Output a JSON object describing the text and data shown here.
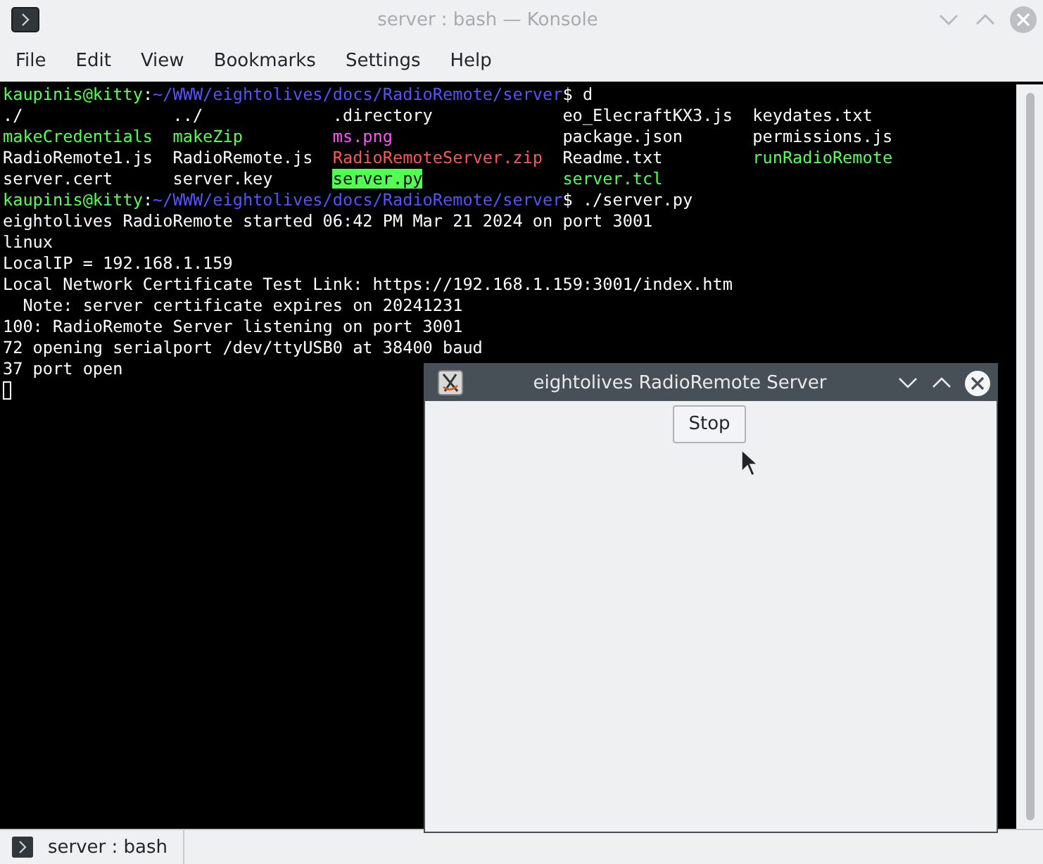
{
  "window": {
    "title": "server : bash — Konsole"
  },
  "menu": [
    "File",
    "Edit",
    "View",
    "Bookmarks",
    "Settings",
    "Help"
  ],
  "terminal": {
    "lines": [
      {
        "kind": "prompt",
        "user": "kaupinis@kitty",
        "separator": ":",
        "path": "~/WWW/eightolives/docs/RadioRemote/server",
        "command": "$ d"
      },
      {
        "kind": "listing",
        "cells": [
          {
            "text": "./",
            "color": "#fcfcfc",
            "highlight": false
          },
          {
            "text": "../",
            "color": "#fcfcfc",
            "highlight": false
          },
          {
            "text": ".directory",
            "color": "#fcfcfc",
            "highlight": false
          },
          {
            "text": "eo_ElecraftKX3.js",
            "color": "#fcfcfc",
            "highlight": false
          },
          {
            "text": "keydates.txt",
            "color": "#fcfcfc",
            "highlight": false
          }
        ]
      },
      {
        "kind": "listing",
        "cells": [
          {
            "text": "makeCredentials",
            "color": "#54ff54",
            "highlight": false
          },
          {
            "text": "makeZip",
            "color": "#54ff54",
            "highlight": false
          },
          {
            "text": "ms.png",
            "color": "#ff54ff",
            "highlight": false
          },
          {
            "text": "package.json",
            "color": "#fcfcfc",
            "highlight": false
          },
          {
            "text": "permissions.js",
            "color": "#fcfcfc",
            "highlight": false
          }
        ]
      },
      {
        "kind": "listing",
        "cells": [
          {
            "text": "RadioRemote1.js",
            "color": "#fcfcfc",
            "highlight": false
          },
          {
            "text": "RadioRemote.js",
            "color": "#fcfcfc",
            "highlight": false
          },
          {
            "text": "RadioRemoteServer.zip",
            "color": "#ff5454",
            "highlight": false
          },
          {
            "text": "Readme.txt",
            "color": "#fcfcfc",
            "highlight": false
          },
          {
            "text": "runRadioRemote",
            "color": "#54ff54",
            "highlight": false
          }
        ]
      },
      {
        "kind": "listing",
        "cells": [
          {
            "text": "server.cert",
            "color": "#fcfcfc",
            "highlight": false
          },
          {
            "text": "server.key",
            "color": "#fcfcfc",
            "highlight": false
          },
          {
            "text": "server.py",
            "color": "#54ff54",
            "highlight": true
          },
          {
            "text": "server.tcl",
            "color": "#54ff54",
            "highlight": false
          }
        ]
      },
      {
        "kind": "prompt",
        "user": "kaupinis@kitty",
        "separator": ":",
        "path": "~/WWW/eightolives/docs/RadioRemote/server",
        "command": "$ ./server.py"
      },
      {
        "kind": "output",
        "text": "eightolives RadioRemote started 06:42 PM Mar 21 2024 on port 3001"
      },
      {
        "kind": "output",
        "text": "linux"
      },
      {
        "kind": "output",
        "text": "LocalIP = 192.168.1.159"
      },
      {
        "kind": "output",
        "text": "Local Network Certificate Test Link: https://192.168.1.159:3001/index.htm"
      },
      {
        "kind": "output",
        "text": "  Note: server certificate expires on 20241231"
      },
      {
        "kind": "output",
        "text": "100: RadioRemote Server listening on port 3001"
      },
      {
        "kind": "output",
        "text": "72 opening serialport /dev/ttyUSB0 at 38400 baud"
      },
      {
        "kind": "output",
        "text": "37 port open"
      },
      {
        "kind": "cursor"
      }
    ]
  },
  "dialog": {
    "title": "eightolives RadioRemote Server",
    "button": "Stop"
  },
  "tabs": [
    {
      "label": "server : bash",
      "selected": true
    }
  ]
}
